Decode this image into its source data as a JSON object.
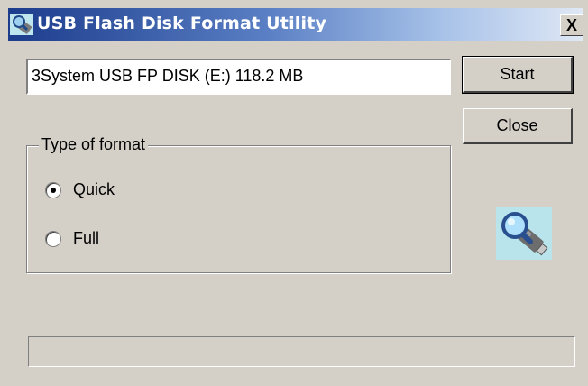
{
  "window": {
    "title": "USB Flash Disk Format Utility",
    "close_glyph": "X",
    "app_icon": "usb-magnifier-icon"
  },
  "drive": {
    "value": "3System USB FP DISK (E:)  118.2 MB"
  },
  "buttons": {
    "start_label": "Start",
    "close_label": "Close"
  },
  "format_group": {
    "label": "Type of format",
    "options": [
      {
        "label": "Quick",
        "selected": true
      },
      {
        "label": "Full",
        "selected": false
      }
    ]
  },
  "progress": {
    "fraction": 0
  },
  "colors": {
    "face": "#d4d0c8",
    "title_start": "#1c3c8c",
    "title_end": "#dfe8f5"
  },
  "decor_icon": "usb-magnifier-icon"
}
